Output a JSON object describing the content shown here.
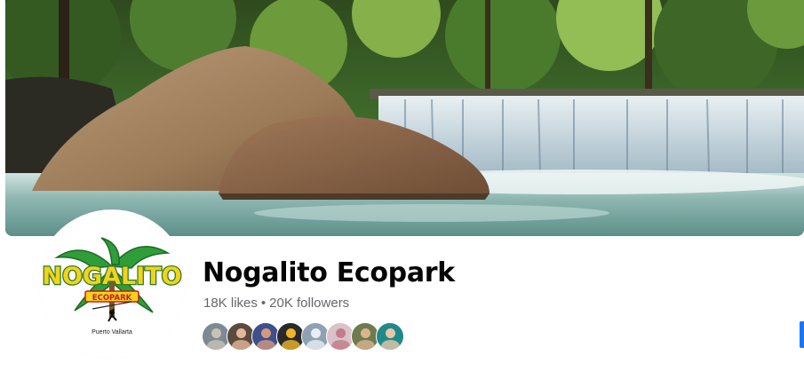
{
  "page": {
    "name": "Nogalito Ecopark",
    "likes": "18K likes",
    "separator": "•",
    "followers": "20K followers"
  },
  "cover_photo": {
    "description_icon": "waterfall-photo"
  },
  "profile_photo": {
    "logo_text": "NOGALITO",
    "logo_banner": "ECOPARK",
    "logo_location": "Puerto Vallarta",
    "colors": {
      "green": "#2e9d3a",
      "yellow": "#f2d21b",
      "red": "#c8191e"
    }
  },
  "follower_avatars": [
    {
      "name": "follower-avatar-1",
      "bg": "#7d8a94",
      "fg": "#c8c2b5"
    },
    {
      "name": "follower-avatar-2",
      "bg": "#5b4a3e",
      "fg": "#e3b79a"
    },
    {
      "name": "follower-avatar-3",
      "bg": "#3f4f8c",
      "fg": "#d19a7e"
    },
    {
      "name": "follower-avatar-4",
      "bg": "#2a2a2a",
      "fg": "#f0b429"
    },
    {
      "name": "follower-avatar-5",
      "bg": "#8fa1b3",
      "fg": "#e9eef2"
    },
    {
      "name": "follower-avatar-6",
      "bg": "#d9c3c9",
      "fg": "#c27b8a"
    },
    {
      "name": "follower-avatar-7",
      "bg": "#6f7a4e",
      "fg": "#d8b48f"
    },
    {
      "name": "follower-avatar-8",
      "bg": "#1f8a8a",
      "fg": "#e8c7a7"
    }
  ],
  "accent_color": "#1877f2"
}
